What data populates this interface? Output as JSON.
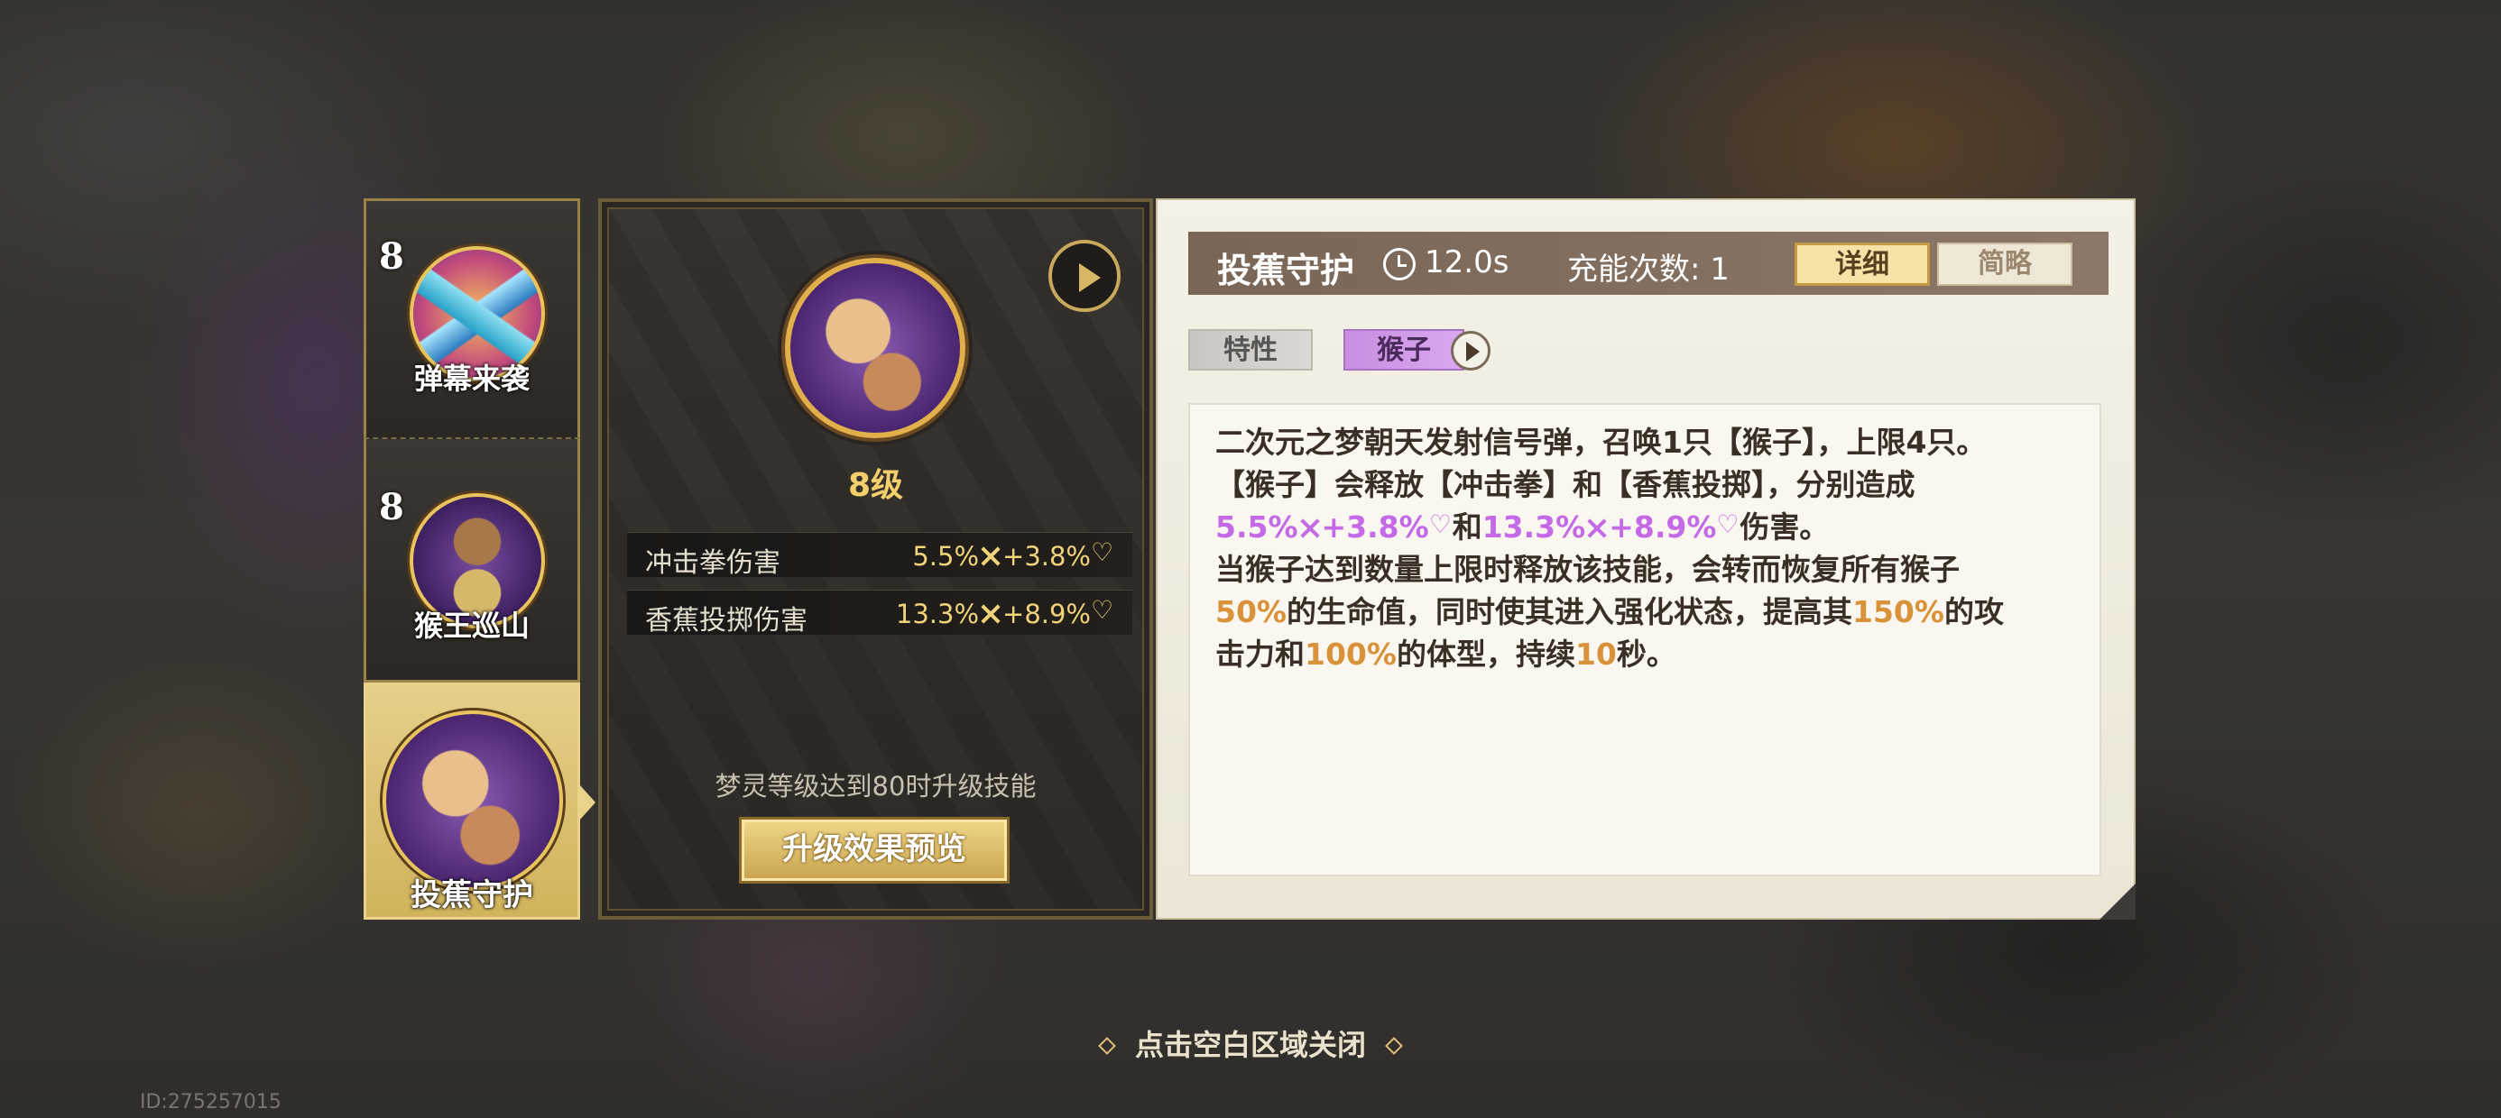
{
  "skills": [
    {
      "level": "8",
      "name": "弹幕来袭",
      "icon": "blue-cards-icon"
    },
    {
      "level": "8",
      "name": "猴王巡山",
      "icon": "monkey-cannon-icon"
    },
    {
      "name": "投蕉守护",
      "icon": "monkey-banana-icon",
      "selected": true
    }
  ],
  "middle": {
    "level_label": "8级",
    "stats": [
      {
        "label": "冲击拳伤害",
        "value_pct1": "5.5%",
        "value_pct2": "+3.8%"
      },
      {
        "label": "香蕉投掷伤害",
        "value_pct1": "13.3%",
        "value_pct2": "+8.9%"
      }
    ],
    "hint": "梦灵等级达到80时升级技能",
    "preview_button": "升级效果预览"
  },
  "detail": {
    "title": "投蕉守护",
    "cooldown": "12.0s",
    "charges": "充能次数: 1",
    "tab_detail": "详细",
    "tab_brief": "简略",
    "tag_trait": "特性",
    "tag_monkey": "猴子",
    "desc": {
      "l1": "二次元之梦朝天发射信号弹，召唤1只【猴子】，上限4只。",
      "l2": "【猴子】会释放【冲击拳】和【香蕉投掷】，分别造成",
      "l3_a": "5.5%",
      "l3_b": "+3.8%",
      "l3_c": "和",
      "l3_d": "13.3%",
      "l3_e": "+8.9%",
      "l3_f": "伤害。",
      "l4": "当猴子达到数量上限时释放该技能，会转而恢复所有猴子",
      "l5_a": "50%",
      "l5_b": "的生命值，同时使其进入强化状态，提高其",
      "l5_c": "150%",
      "l5_d": "的攻",
      "l6_a": "击力和",
      "l6_b": "100%",
      "l6_c": "的体型，持续",
      "l6_d": "10",
      "l6_e": "秒。"
    }
  },
  "footer": {
    "close_hint": "点击空白区域关闭",
    "uid": "ID:275257015"
  },
  "colors": {
    "gold": "#f1d37a",
    "purple_value": "#c46ae6",
    "orange_value": "#d9923a"
  }
}
